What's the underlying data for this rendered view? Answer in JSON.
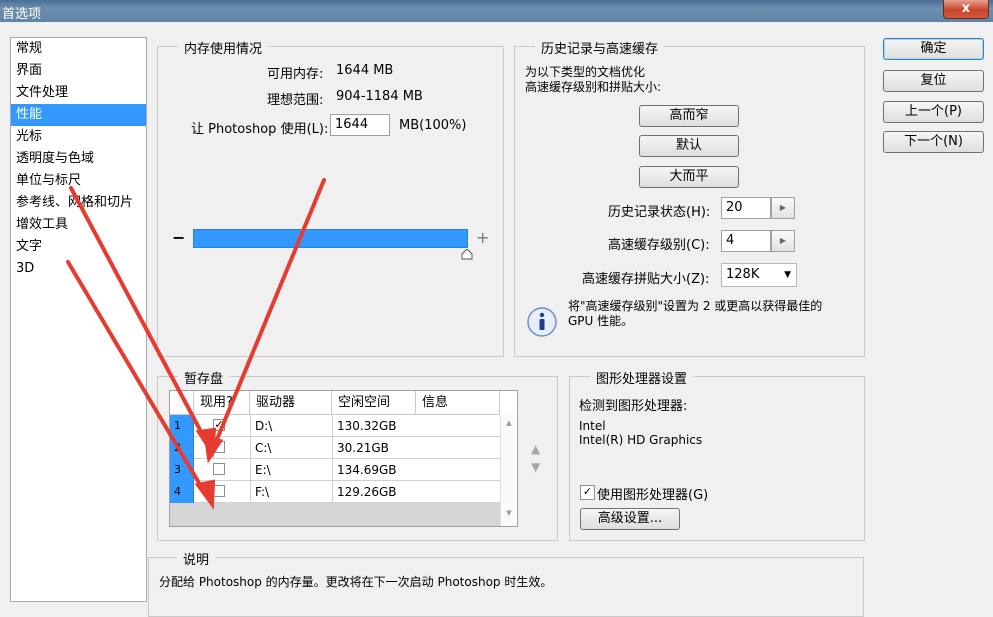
{
  "window": {
    "title": "首选项",
    "close_label": "x"
  },
  "categories": [
    {
      "label": "常规"
    },
    {
      "label": "界面"
    },
    {
      "label": "文件处理"
    },
    {
      "label": "性能",
      "selected": true
    },
    {
      "label": "光标"
    },
    {
      "label": "透明度与色域"
    },
    {
      "label": "单位与标尺"
    },
    {
      "label": "参考线、网格和切片"
    },
    {
      "label": "增效工具"
    },
    {
      "label": "文字"
    },
    {
      "label": "3D"
    }
  ],
  "memory": {
    "title": "内存使用情况",
    "available_label": "可用内存:",
    "available_value": "1644 MB",
    "ideal_label": "理想范围:",
    "ideal_value": "904-1184 MB",
    "let_label": "让 Photoshop 使用(L):",
    "let_value": "1644",
    "let_unit": "MB(100%)",
    "minus": "−",
    "plus": "+",
    "slider_fraction": 1.0
  },
  "history": {
    "title": "历史记录与高速缓存",
    "desc_line1": "为以下类型的文档优化",
    "desc_line2": "高速缓存级别和拼贴大小:",
    "btn_tall_thin": "高而窄",
    "btn_default": "默认",
    "btn_big_flat": "大而平",
    "states_label": "历史记录状态(H):",
    "states_value": "20",
    "levels_label": "高速缓存级别(C):",
    "levels_value": "4",
    "tile_label": "高速缓存拼贴大小(Z):",
    "tile_value": "128K",
    "info_line1": "将\"高速缓存级别\"设置为 2 或更高以获得最佳的",
    "info_line2": "GPU 性能。"
  },
  "scratch": {
    "title": "暂存盘",
    "headers": {
      "active": "现用?",
      "drive": "驱动器",
      "free": "空闲空间",
      "info": "信息"
    },
    "rows": [
      {
        "num": "1",
        "checked": "✓",
        "drive": "D:\\",
        "free": "130.32GB"
      },
      {
        "num": "2",
        "checked": "",
        "drive": "C:\\",
        "free": "30.21GB"
      },
      {
        "num": "3",
        "checked": "",
        "drive": "E:\\",
        "free": "134.69GB"
      },
      {
        "num": "4",
        "checked": "",
        "drive": "F:\\",
        "free": "129.26GB"
      }
    ],
    "up_arrow": "▲",
    "down_arrow": "▼"
  },
  "gpu": {
    "title": "图形处理器设置",
    "detected_label": "检测到图形处理器:",
    "vendor": "Intel",
    "model": "Intel(R) HD Graphics",
    "use_checked": "✓",
    "use_label": "使用图形处理器(G)",
    "advanced_label": "高级设置..."
  },
  "description": {
    "title": "说明",
    "text": "分配给 Photoshop 的内存量。更改将在下一次启动 Photoshop 时生效。"
  },
  "buttons": {
    "ok": "确定",
    "reset": "复位",
    "prev": "上一个(P)",
    "next": "下一个(N)"
  },
  "colors": {
    "selection": "#3399ff",
    "annotation_arrow": "#e53b30"
  }
}
